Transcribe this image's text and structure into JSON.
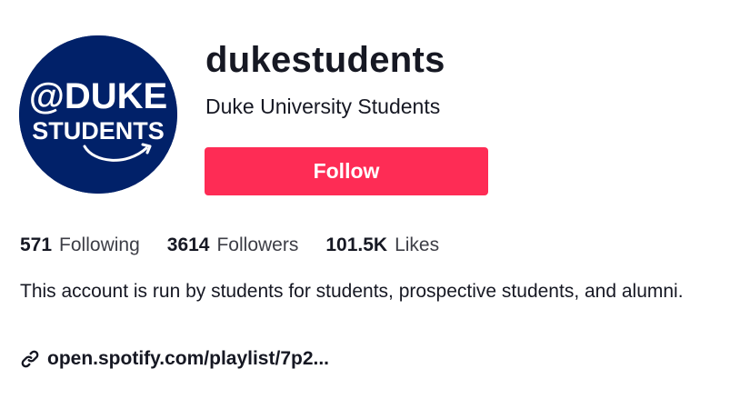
{
  "profile": {
    "avatar": {
      "line1": "@DUKE",
      "line2": "STUDENTS",
      "bg_color": "#012169"
    },
    "username": "dukestudents",
    "display_name": "Duke University Students",
    "follow_label": "Follow"
  },
  "stats": [
    {
      "count": "571",
      "label": "Following"
    },
    {
      "count": "3614",
      "label": "Followers"
    },
    {
      "count": "101.5K",
      "label": "Likes"
    }
  ],
  "bio": "This account is run by students for students, prospective students, and alumni.",
  "link": {
    "text": "open.spotify.com/playlist/7p2...",
    "icon": "link-icon"
  },
  "colors": {
    "accent": "#fe2c55",
    "text": "#161823"
  }
}
